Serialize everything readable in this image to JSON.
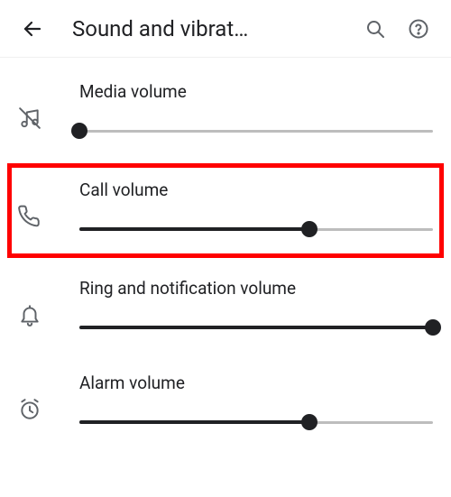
{
  "header": {
    "title": "Sound and vibrat…"
  },
  "icons": {
    "back": "back-arrow",
    "search": "search",
    "help": "help"
  },
  "rows": [
    {
      "label": "Media volume",
      "value": 0,
      "icon": "media-muted",
      "highlighted": false
    },
    {
      "label": "Call volume",
      "value": 65,
      "icon": "phone",
      "highlighted": true
    },
    {
      "label": "Ring and notification volume",
      "value": 100,
      "icon": "bell",
      "highlighted": false
    },
    {
      "label": "Alarm volume",
      "value": 65,
      "icon": "alarm",
      "highlighted": false
    }
  ]
}
